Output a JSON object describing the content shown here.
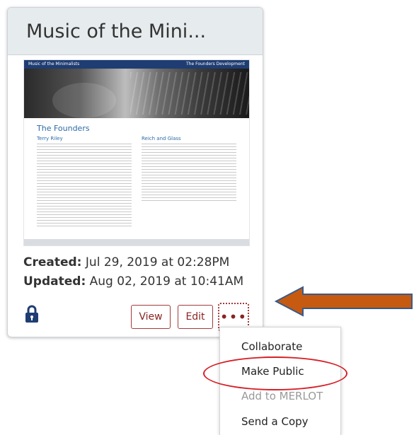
{
  "card": {
    "title": "Music of the Mini...",
    "thumbnail": {
      "nav_title": "Music of the Minimalists",
      "nav_links": "The Founders  Development",
      "heading": "The Founders",
      "col1_heading": "Terry Riley",
      "col2_heading": "Reich and Glass"
    },
    "created_label": "Created:",
    "created_value": "Jul 29, 2019 at 02:28PM",
    "updated_label": "Updated:",
    "updated_value": "Aug 02, 2019 at 10:41AM",
    "buttons": {
      "view": "View",
      "edit": "Edit",
      "more": "•••"
    }
  },
  "menu": {
    "items": [
      {
        "label": "Collaborate"
      },
      {
        "label": "Make Public"
      },
      {
        "label": "Add to MERLOT"
      },
      {
        "label": "Send a Copy"
      }
    ]
  },
  "colors": {
    "accent_red": "#a23b3b",
    "header_bg": "#e6ebee",
    "lock": "#1f3d72",
    "arrow": "#c65a10",
    "highlight": "#d61f26"
  },
  "icons": {
    "lock": "lock-icon",
    "more": "more-options-icon",
    "arrow": "arrow-left-icon"
  }
}
